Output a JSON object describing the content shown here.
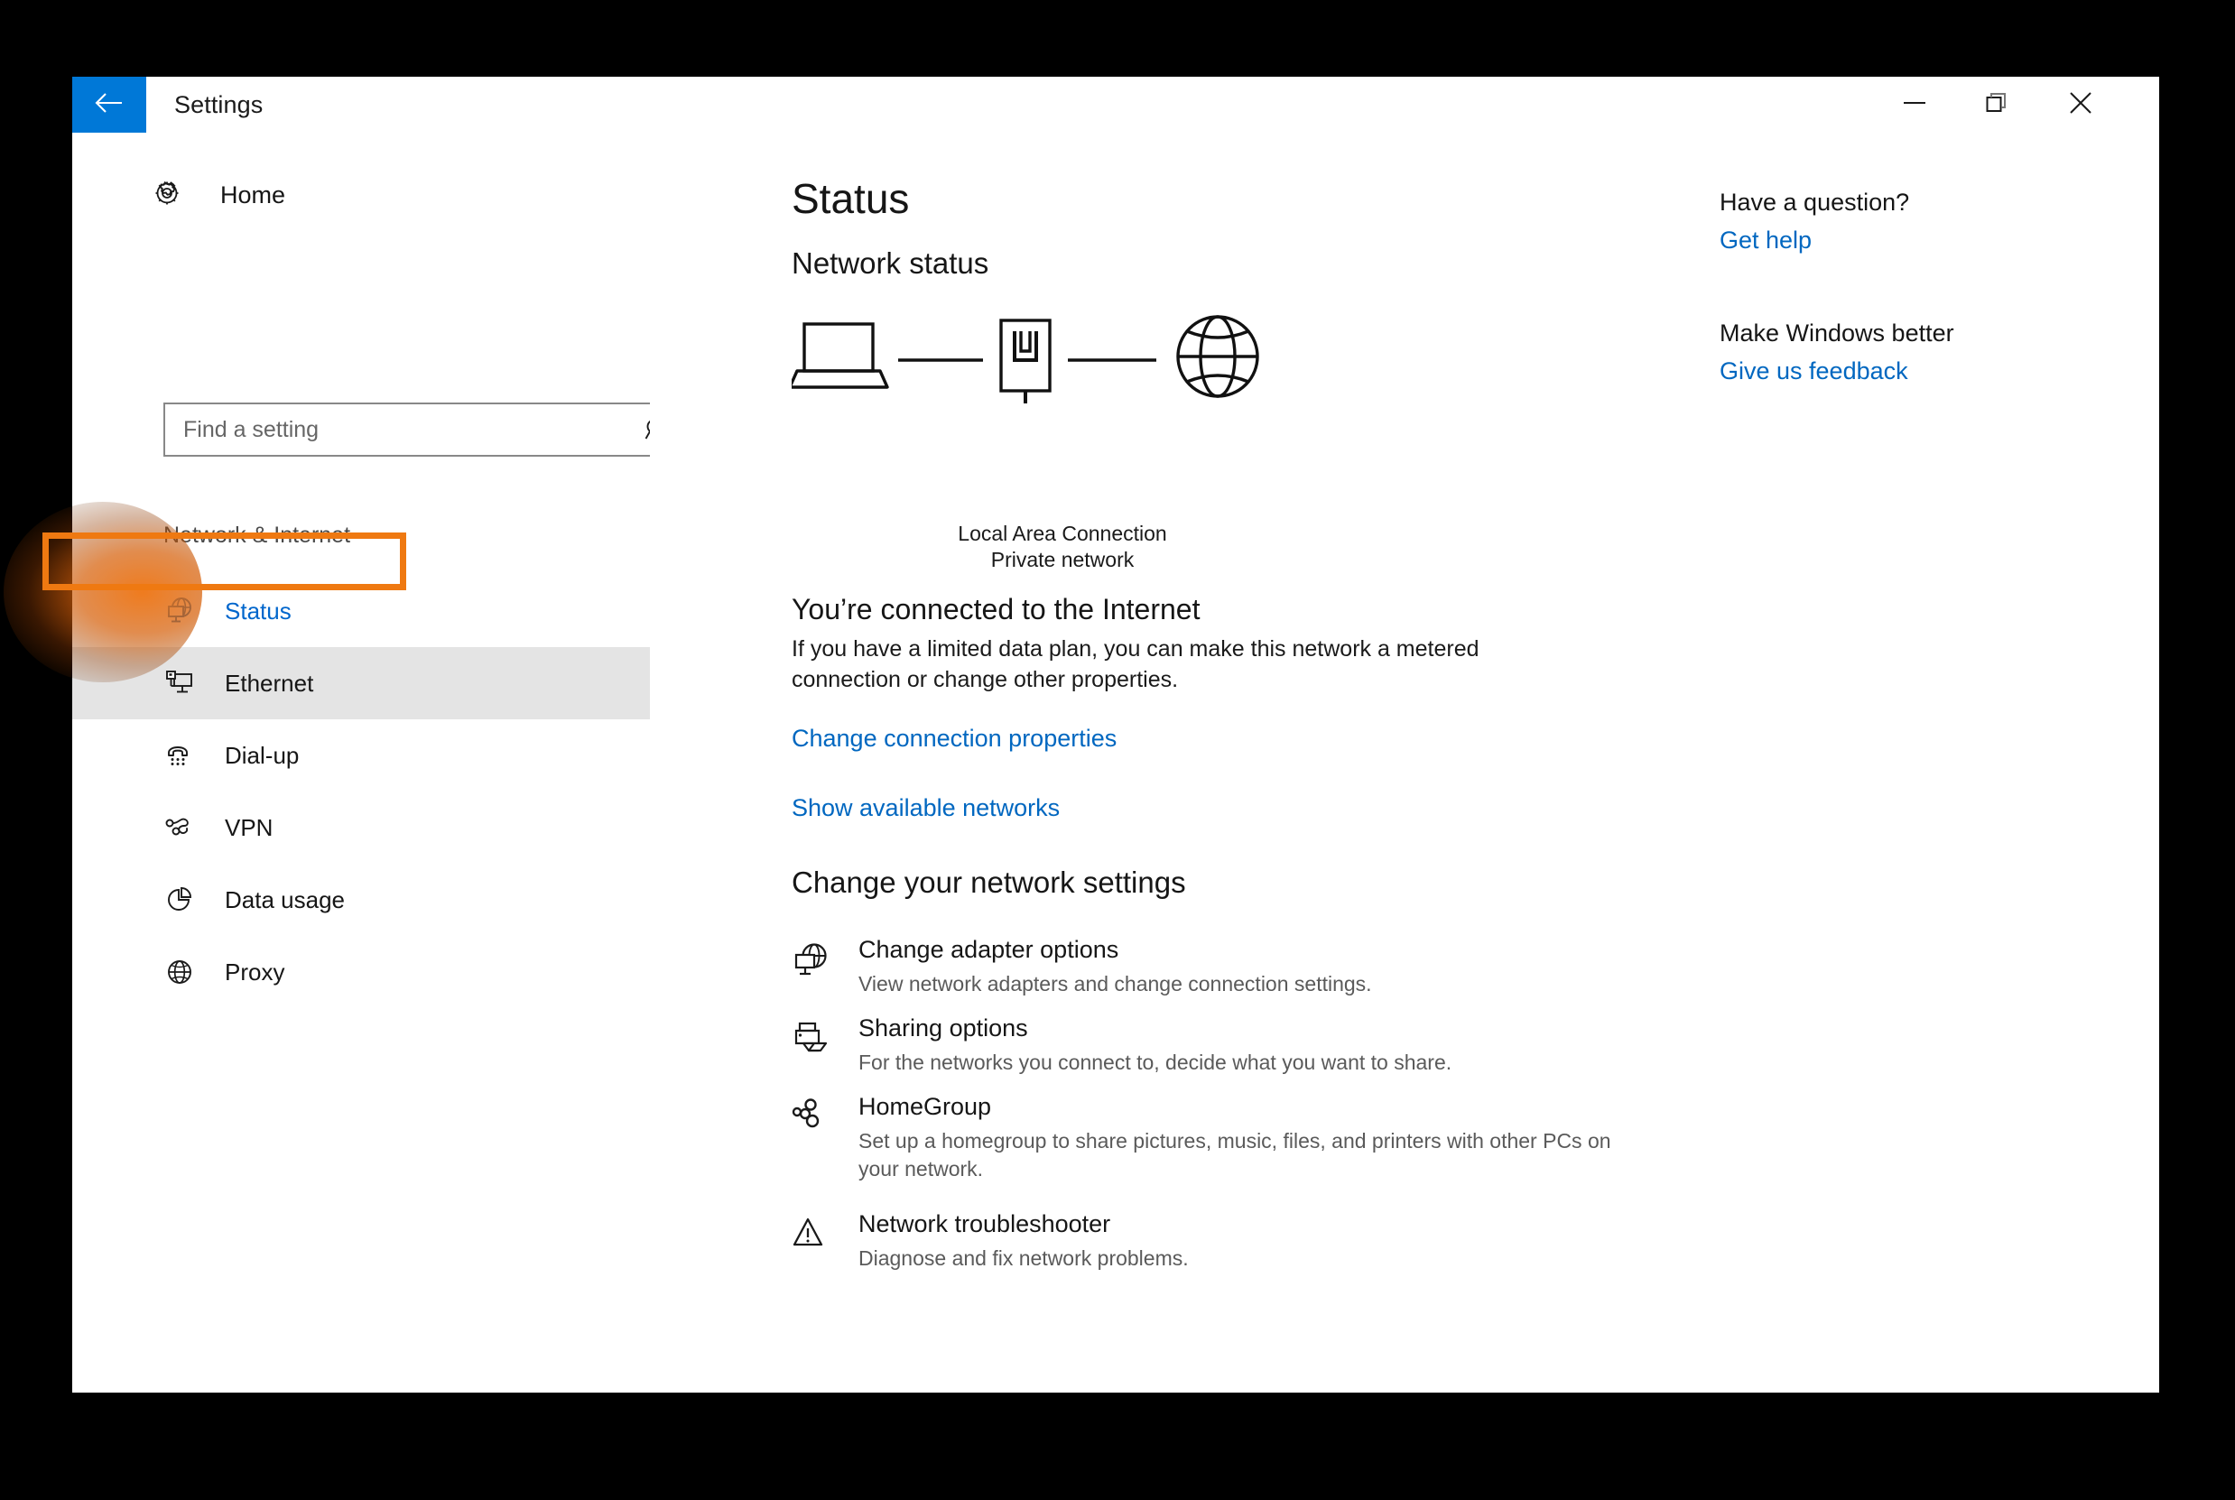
{
  "window": {
    "title": "Settings",
    "back_icon": "back-arrow-icon",
    "controls": {
      "minimize": "minimize-icon",
      "restore": "restore-icon",
      "close": "close-icon"
    },
    "accent_color": "#0078d7",
    "highlight_color": "#ef7911"
  },
  "sidebar": {
    "home": {
      "label": "Home",
      "icon": "gear-icon"
    },
    "search": {
      "placeholder": "Find a setting",
      "value": "",
      "icon": "search-icon"
    },
    "group_header": "Network & Internet",
    "items": [
      {
        "label": "Status",
        "icon": "globe-monitor-icon",
        "selected": false,
        "active": true
      },
      {
        "label": "Ethernet",
        "icon": "ethernet-monitor-icon",
        "selected": true,
        "active": false
      },
      {
        "label": "Dial-up",
        "icon": "phone-dialpad-icon",
        "selected": false,
        "active": false
      },
      {
        "label": "VPN",
        "icon": "vpn-key-icon",
        "selected": false,
        "active": false
      },
      {
        "label": "Data usage",
        "icon": "pie-chart-icon",
        "selected": false,
        "active": false
      },
      {
        "label": "Proxy",
        "icon": "globe-icon",
        "selected": false,
        "active": false
      }
    ]
  },
  "main": {
    "page_title": "Status",
    "network_status_title": "Network status",
    "diagram": {
      "device_icon": "laptop-icon",
      "adapter_icon": "network-adapter-icon",
      "internet_icon": "globe-icon",
      "connection_name": "Local Area Connection",
      "connection_type": "Private network"
    },
    "connected_heading": "You’re connected to the Internet",
    "connected_description": "If you have a limited data plan, you can make this network a metered connection or change other properties.",
    "links": [
      {
        "label": "Change connection properties"
      },
      {
        "label": "Show available networks"
      }
    ],
    "change_settings_title": "Change your network settings",
    "settings_items": [
      {
        "icon": "globe-monitor-icon",
        "title": "Change adapter options",
        "desc": "View network adapters and change connection settings."
      },
      {
        "icon": "printer-folder-icon",
        "title": "Sharing options",
        "desc": "For the networks you connect to, decide what you want to share."
      },
      {
        "icon": "homegroup-icon",
        "title": "HomeGroup",
        "desc": "Set up a homegroup to share pictures, music, files, and printers with other PCs on your network."
      },
      {
        "icon": "warning-triangle-icon",
        "title": "Network troubleshooter",
        "desc": "Diagnose and fix network problems."
      }
    ]
  },
  "help_panel": {
    "question_heading": "Have a question?",
    "question_link": "Get help",
    "feedback_heading": "Make Windows better",
    "feedback_link": "Give us feedback"
  }
}
